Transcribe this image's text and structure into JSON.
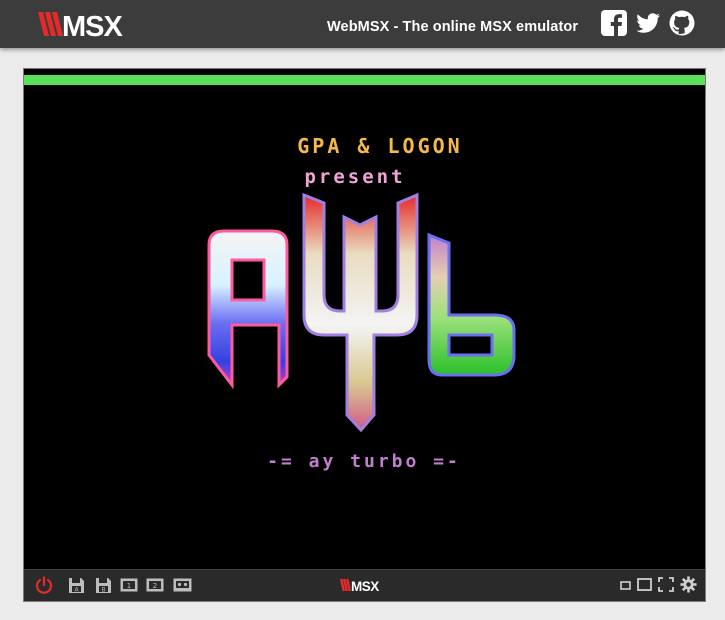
{
  "header": {
    "logo_text": "WMSX",
    "tagline": "WebMSX - The online MSX emulator",
    "social": [
      {
        "icon": "facebook-icon"
      },
      {
        "icon": "twitter-icon"
      },
      {
        "icon": "github-icon"
      }
    ]
  },
  "emulator": {
    "power_led_color": "#5ae05a",
    "screen": {
      "credit_line_1": "GPA & LOGON",
      "credit_line_2": "present",
      "logo_text": "AYT",
      "byline": "-= ay turbo =-"
    },
    "control_bar": {
      "logo_text": "WMSX",
      "left_buttons": [
        {
          "icon": "power-icon"
        },
        {
          "icon": "floppy-a-icon",
          "label": "A"
        },
        {
          "icon": "floppy-b-icon",
          "label": "B"
        },
        {
          "icon": "cartridge-1-icon",
          "label": "1"
        },
        {
          "icon": "cartridge-2-icon",
          "label": "2"
        },
        {
          "icon": "tape-icon"
        }
      ],
      "right_buttons": [
        {
          "icon": "screen-small-icon"
        },
        {
          "icon": "screen-large-icon"
        },
        {
          "icon": "fullscreen-icon"
        },
        {
          "icon": "settings-gear-icon"
        }
      ]
    }
  },
  "colors": {
    "header_bg": "#3c3c3c",
    "page_bg": "#ebebeb",
    "logo_red": "#e52a2a",
    "power_red": "#e52a2a"
  }
}
